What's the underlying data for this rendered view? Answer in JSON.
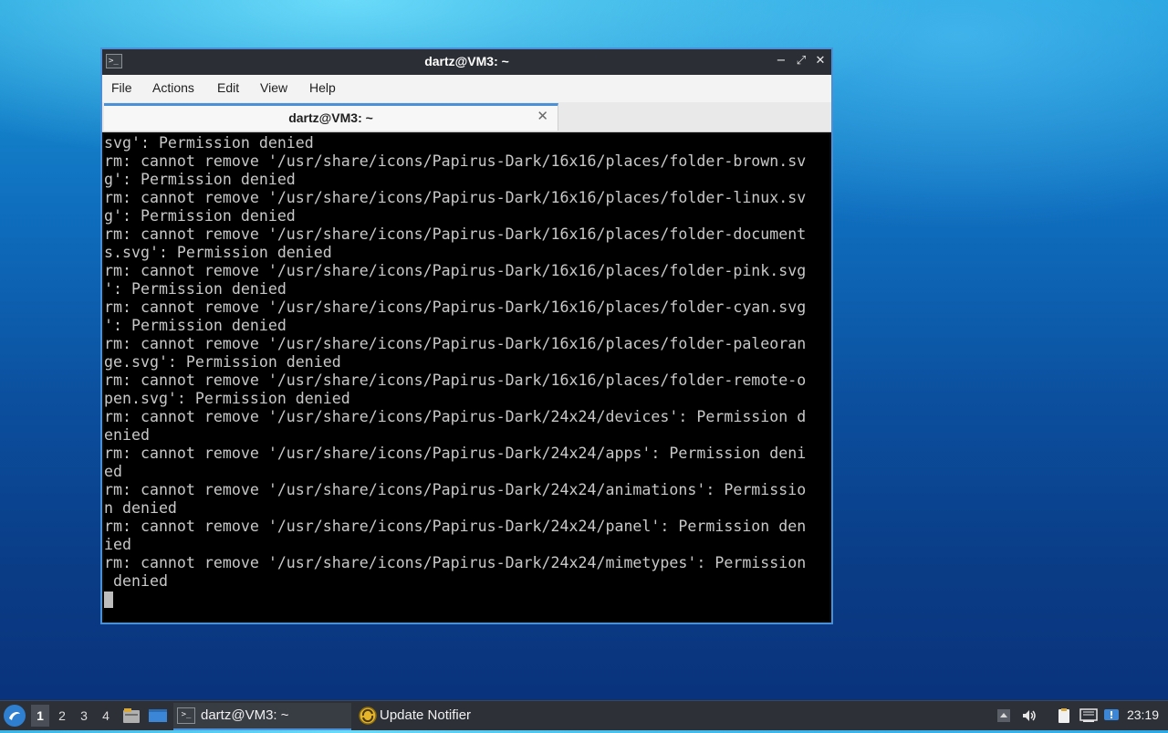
{
  "window": {
    "title": "dartz@VM3: ~",
    "controls": {
      "minimize": "−",
      "maximize": "⤢",
      "close": "✕"
    }
  },
  "menu": [
    "File",
    "Actions",
    "Edit",
    "View",
    "Help"
  ],
  "tab": {
    "label": "dartz@VM3: ~",
    "close": "✕"
  },
  "terminal": {
    "lines": [
      "svg': Permission denied",
      "rm: cannot remove '/usr/share/icons/Papirus-Dark/16x16/places/folder-brown.sv",
      "g': Permission denied",
      "rm: cannot remove '/usr/share/icons/Papirus-Dark/16x16/places/folder-linux.sv",
      "g': Permission denied",
      "rm: cannot remove '/usr/share/icons/Papirus-Dark/16x16/places/folder-document",
      "s.svg': Permission denied",
      "rm: cannot remove '/usr/share/icons/Papirus-Dark/16x16/places/folder-pink.svg",
      "': Permission denied",
      "rm: cannot remove '/usr/share/icons/Papirus-Dark/16x16/places/folder-cyan.svg",
      "': Permission denied",
      "rm: cannot remove '/usr/share/icons/Papirus-Dark/16x16/places/folder-paleoran",
      "ge.svg': Permission denied",
      "rm: cannot remove '/usr/share/icons/Papirus-Dark/16x16/places/folder-remote-o",
      "pen.svg': Permission denied",
      "rm: cannot remove '/usr/share/icons/Papirus-Dark/24x24/devices': Permission d",
      "enied",
      "rm: cannot remove '/usr/share/icons/Papirus-Dark/24x24/apps': Permission deni",
      "ed",
      "rm: cannot remove '/usr/share/icons/Papirus-Dark/24x24/animations': Permissio",
      "n denied",
      "rm: cannot remove '/usr/share/icons/Papirus-Dark/24x24/panel': Permission den",
      "ied",
      "rm: cannot remove '/usr/share/icons/Papirus-Dark/24x24/mimetypes': Permission",
      " denied"
    ]
  },
  "taskbar": {
    "workspaces": [
      "1",
      "2",
      "3",
      "4"
    ],
    "active_workspace": "1",
    "tasks": [
      {
        "label": "dartz@VM3: ~",
        "icon": "terminal-icon"
      },
      {
        "label": "Update Notifier",
        "icon": "update-notifier-icon"
      }
    ],
    "clock": "23:19"
  },
  "colors": {
    "accent": "#4a90d9",
    "terminal_bg": "#000000",
    "terminal_fg": "#c8c8c8",
    "titlebar": "#2b2f35",
    "taskbar": "#2d3036"
  }
}
